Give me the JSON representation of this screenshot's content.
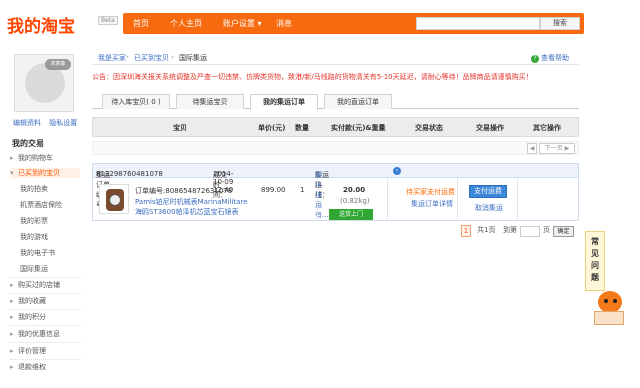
{
  "header": {
    "logo": "我的淘宝",
    "beta": "Beta",
    "nav": [
      {
        "label": "首页"
      },
      {
        "label": "个人主页"
      },
      {
        "label": "账户设置 ▾"
      },
      {
        "label": "消息"
      }
    ],
    "search_placeholder": "",
    "search_button": "搜索"
  },
  "sidebar": {
    "avatar_bubble": "求真像",
    "profile_links": [
      "编辑资料",
      "隐私设置"
    ],
    "title": "我的交易",
    "items": [
      {
        "label": "我的购物车",
        "expanded": false
      },
      {
        "label": "已买到的宝贝",
        "expanded": true
      },
      {
        "label": "我的拍卖",
        "sub": true
      },
      {
        "label": "机票酒店保险",
        "sub": true
      },
      {
        "label": "我的彩票",
        "sub": true
      },
      {
        "label": "我的游戏",
        "sub": true
      },
      {
        "label": "我的电子书",
        "sub": true
      },
      {
        "label": "国际集运",
        "sub": true
      },
      {
        "label": "购买过的店铺",
        "expanded": false
      },
      {
        "label": "我的收藏",
        "expanded": false
      },
      {
        "label": "我的积分",
        "expanded": false
      },
      {
        "label": "我的优惠信息",
        "expanded": false
      },
      {
        "label": "评价管理",
        "expanded": false
      },
      {
        "label": "退款维权",
        "expanded": false
      }
    ]
  },
  "breadcrumb": [
    "我是买家",
    "已买到宝贝",
    "国际集运"
  ],
  "help": "查看帮助",
  "notice": {
    "prefix": "公告：",
    "text": "因深圳海关报关系统调整及严查一切违禁、仿牌类货物，致港/新/马线路的货物清关有5-10天延迟，请耐心等待！品牌商品请谨慎购买！"
  },
  "tabs": [
    {
      "label": "待入库宝贝( 0 )",
      "active": false
    },
    {
      "label": "待集运宝贝",
      "active": false
    },
    {
      "label": "我的集运订单",
      "active": true
    },
    {
      "label": "我的直运订单",
      "active": false
    }
  ],
  "table_headers": [
    "宝贝",
    "单价(元)",
    "数量",
    "实付款(元)&重量",
    "交易状态",
    "交易操作",
    "其它操作"
  ],
  "pager_top": {
    "prev": "◀",
    "next": "下一页 ▶"
  },
  "order": {
    "order_no_label": "集运订单编号：",
    "order_no": "813298760481078",
    "created_label": "成交时间：",
    "created": "2014-10-09 12:40",
    "route_label": "集运路线：",
    "route": "顺丰速运有...",
    "item_order_label": "订单编号:",
    "item_order_no": "808654872631078",
    "item_title_1": "Pamis铂尼时机械表MarinaMilitare",
    "item_title_2": "海鸥ST3600帕泽机芯蓝宝石镜表",
    "price": "899.00",
    "quantity": "1",
    "total": "20.00",
    "weight": "(0.82kg)",
    "shipping_badge": "送货上门",
    "status": "待买家支付运费",
    "status_detail": "集运订单详情",
    "pay_button": "支付运费",
    "cancel_link": "取消集运"
  },
  "pager_bottom": {
    "current": "1",
    "total_pages": "共1页",
    "goto": "到第",
    "page_unit": "页",
    "confirm": "确定"
  },
  "faq": [
    "常",
    "见",
    "问",
    "题"
  ]
}
